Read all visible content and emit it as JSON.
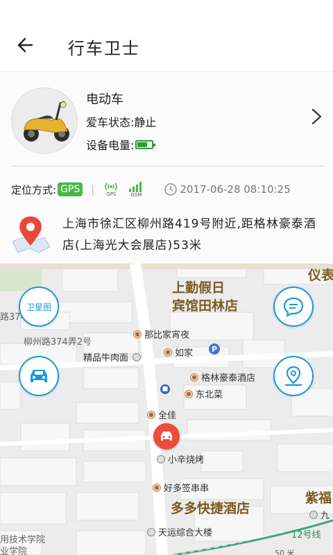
{
  "header": {
    "title": "行车卫士"
  },
  "vehicle": {
    "name": "电动车",
    "status_label": "爱车状态:",
    "status_value": "静止",
    "battery_label": "设备电量:",
    "battery_level": 0.7
  },
  "location": {
    "mode_label": "定位方式:",
    "mode": "GPS",
    "gps_signal_label": "GPS",
    "gsm_signal_label": "GSM",
    "timestamp": "2017-06-28 08:10:25",
    "address": "上海市徐汇区柳州路419号附近,距格林豪泰酒店(上海光大会展店)53米"
  },
  "colors": {
    "accent": "#1a9ad8",
    "gps_green": "#49b748",
    "marker_red": "#ee4a3d"
  },
  "map": {
    "buttons": {
      "satellite_label": "卫星图"
    },
    "pois": {
      "hotel_top_line1": "上勤假日",
      "hotel_top_line2": "宾馆田林店",
      "yibiao": "仪表",
      "nabijia": "那比家宵夜",
      "rujia": "如家",
      "niuroumian": "精品牛肉面",
      "gelin": "格林豪泰酒店",
      "dongbeicai": "东北菜",
      "quanjia": "全佳",
      "xiaoxin": "小辛烧烤",
      "haoduo": "好多签串串",
      "duoduo": "多多快捷酒店",
      "zise": "紫福",
      "jiu": "九",
      "tianyun": "天运综合大楼",
      "school1": "用技术学院",
      "school2": "业学院",
      "street1": "柳州路374弄2号",
      "street2": "路374",
      "metro": "12号线",
      "distance": "50 米"
    }
  }
}
